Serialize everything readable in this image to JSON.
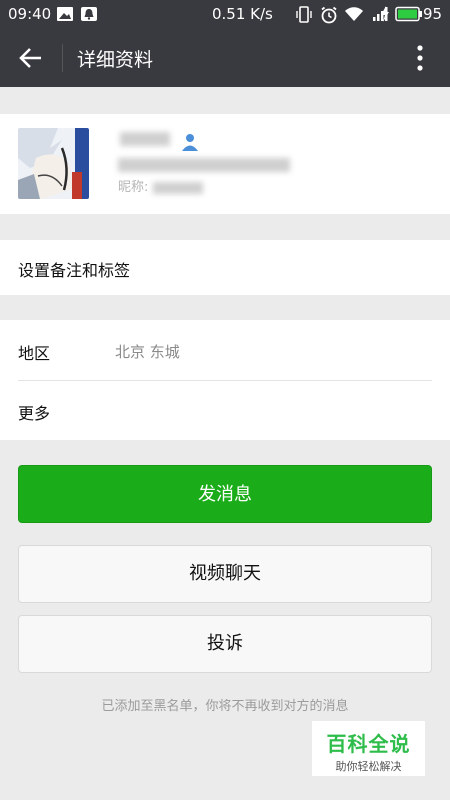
{
  "status_bar": {
    "time": "09:40",
    "network_speed": "0.51 K/s",
    "battery_level": "95",
    "icons": [
      "image-notification-icon",
      "bell-notification-icon",
      "vibrate-icon",
      "alarm-icon",
      "wifi-icon",
      "signal-icon",
      "charging-icon",
      "battery-icon"
    ]
  },
  "header": {
    "title": "详细资料",
    "back_icon": "back-arrow-icon",
    "more_icon": "more-vertical-icon"
  },
  "profile": {
    "nickname_prefix": "昵称:",
    "nickname_blurred": "",
    "name_blurred": "",
    "wechat_id_blurred": "",
    "contact_icon": "person-contact-icon"
  },
  "menu": {
    "remark_tags": "设置备注和标签",
    "region_label": "地区",
    "region_value": "北京  东城",
    "more_label": "更多"
  },
  "actions": {
    "send_message": "发消息",
    "video_chat": "视频聊天",
    "report": "投诉"
  },
  "notice": "已添加至黑名单，你将不再收到对方的消息",
  "watermark": {
    "main": "百科全说",
    "sub": "助你轻松解决"
  },
  "colors": {
    "header_bg": "#393a3f",
    "primary_button": "#1aad19",
    "page_bg": "#ebebeb",
    "watermark_green": "#2ebd4a"
  }
}
